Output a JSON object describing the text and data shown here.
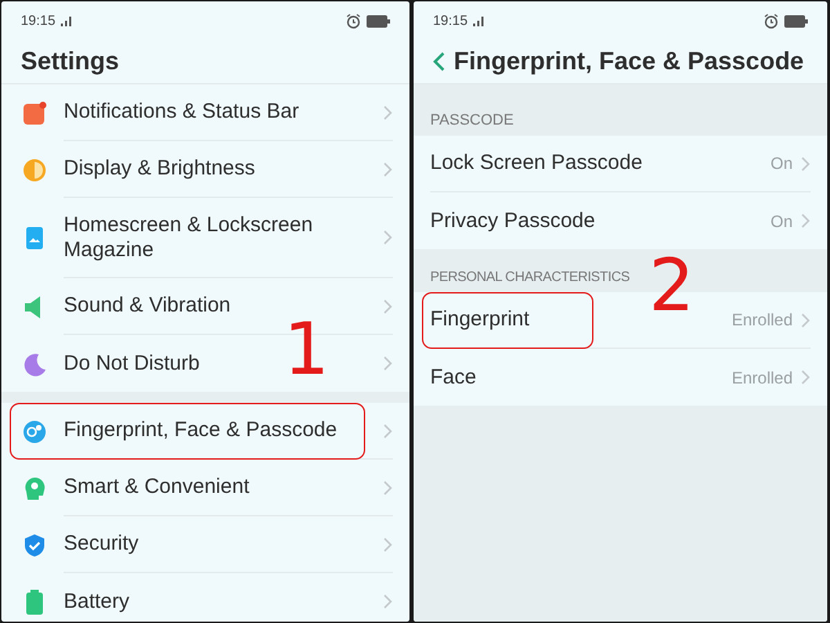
{
  "screens": [
    {
      "status_bar": {
        "time": "19:15"
      },
      "title": "Settings",
      "back": false,
      "annotation": "1",
      "groups": [
        {
          "items": [
            {
              "label": "Notifications & Status Bar",
              "highlighted": false
            },
            {
              "label": "Display & Brightness",
              "highlighted": false
            },
            {
              "label": "Homescreen & Lockscreen Magazine",
              "highlighted": false
            },
            {
              "label": "Sound & Vibration",
              "highlighted": false
            },
            {
              "label": "Do Not Disturb",
              "highlighted": false
            }
          ]
        },
        {
          "items": [
            {
              "label": "Fingerprint, Face & Passcode",
              "highlighted": true
            },
            {
              "label": "Smart & Convenient",
              "highlighted": false
            },
            {
              "label": "Security",
              "highlighted": false
            },
            {
              "label": "Battery",
              "highlighted": false
            }
          ]
        }
      ]
    },
    {
      "status_bar": {
        "time": "19:15"
      },
      "title": "Fingerprint, Face & Passcode",
      "back": true,
      "annotation": "2",
      "groups": [
        {
          "header": "PASSCODE",
          "items": [
            {
              "label": "Lock Screen Passcode",
              "value": "On",
              "highlighted": false
            },
            {
              "label": "Privacy Passcode",
              "value": "On",
              "highlighted": false
            }
          ]
        },
        {
          "header": "PERSONAL CHARACTERISTICS",
          "items": [
            {
              "label": "Fingerprint",
              "value": "Enrolled",
              "highlighted": true
            },
            {
              "label": "Face",
              "value": "Enrolled",
              "highlighted": false
            }
          ]
        }
      ]
    }
  ]
}
